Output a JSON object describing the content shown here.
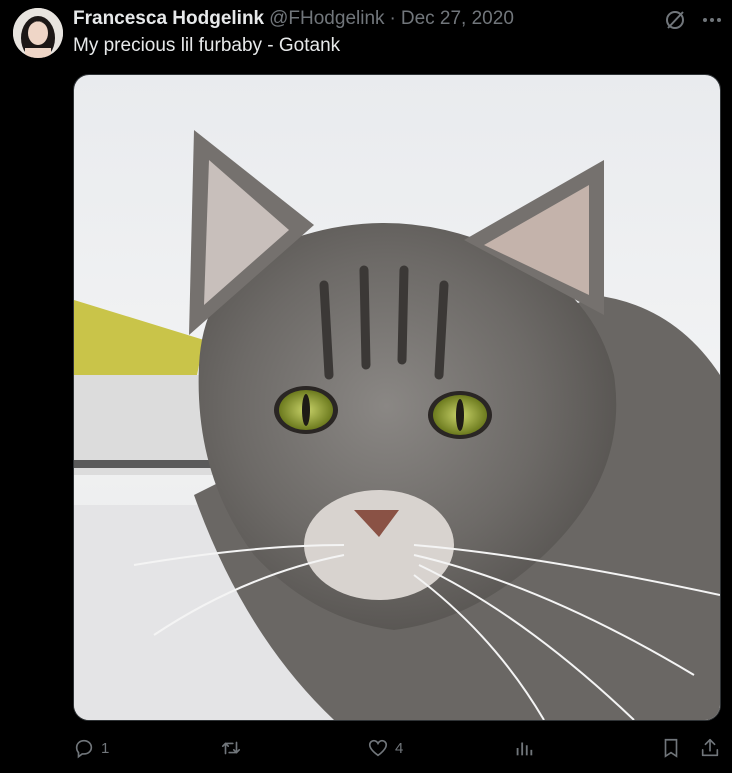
{
  "author": {
    "name": "Francesca Hodgelink",
    "handle": "@FHodgelink",
    "separator": "·",
    "date": "Dec 27, 2020"
  },
  "tweet": {
    "text": "My precious lil furbaby - Gotank"
  },
  "icons": {
    "grok": "grok-icon",
    "more": "more-icon",
    "reply": "reply-icon",
    "retweet": "retweet-icon",
    "like": "like-icon",
    "views": "views-icon",
    "bookmark": "bookmark-icon",
    "share": "share-icon"
  },
  "actions": {
    "reply_count": "1",
    "retweet_count": "",
    "like_count": "4"
  },
  "colors": {
    "background": "#000000",
    "text": "#e7e9ea",
    "muted": "#71767b"
  }
}
